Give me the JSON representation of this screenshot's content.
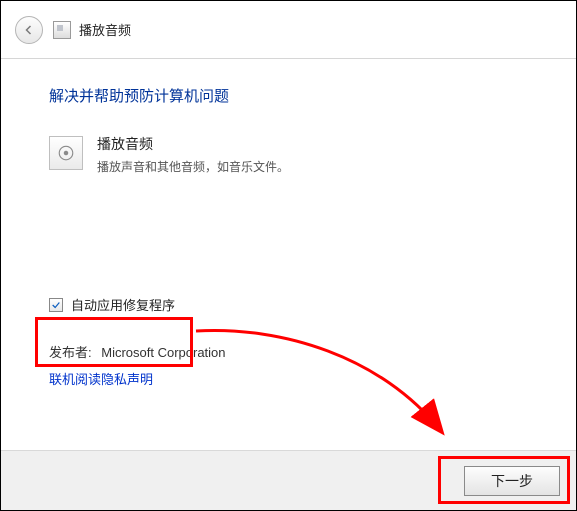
{
  "title_bar": {
    "window_title": "播放音频"
  },
  "content": {
    "heading": "解决并帮助预防计算机问题",
    "item": {
      "title": "播放音频",
      "description": "播放声音和其他音频，如音乐文件。"
    },
    "auto_fix": {
      "checked": true,
      "label": "自动应用修复程序"
    },
    "publisher": {
      "label": "发布者:",
      "value": "Microsoft Corporation"
    },
    "privacy_link": "联机阅读隐私声明"
  },
  "footer": {
    "next_button": "下一步"
  },
  "annotations": {
    "highlight_color": "#ff0000"
  }
}
